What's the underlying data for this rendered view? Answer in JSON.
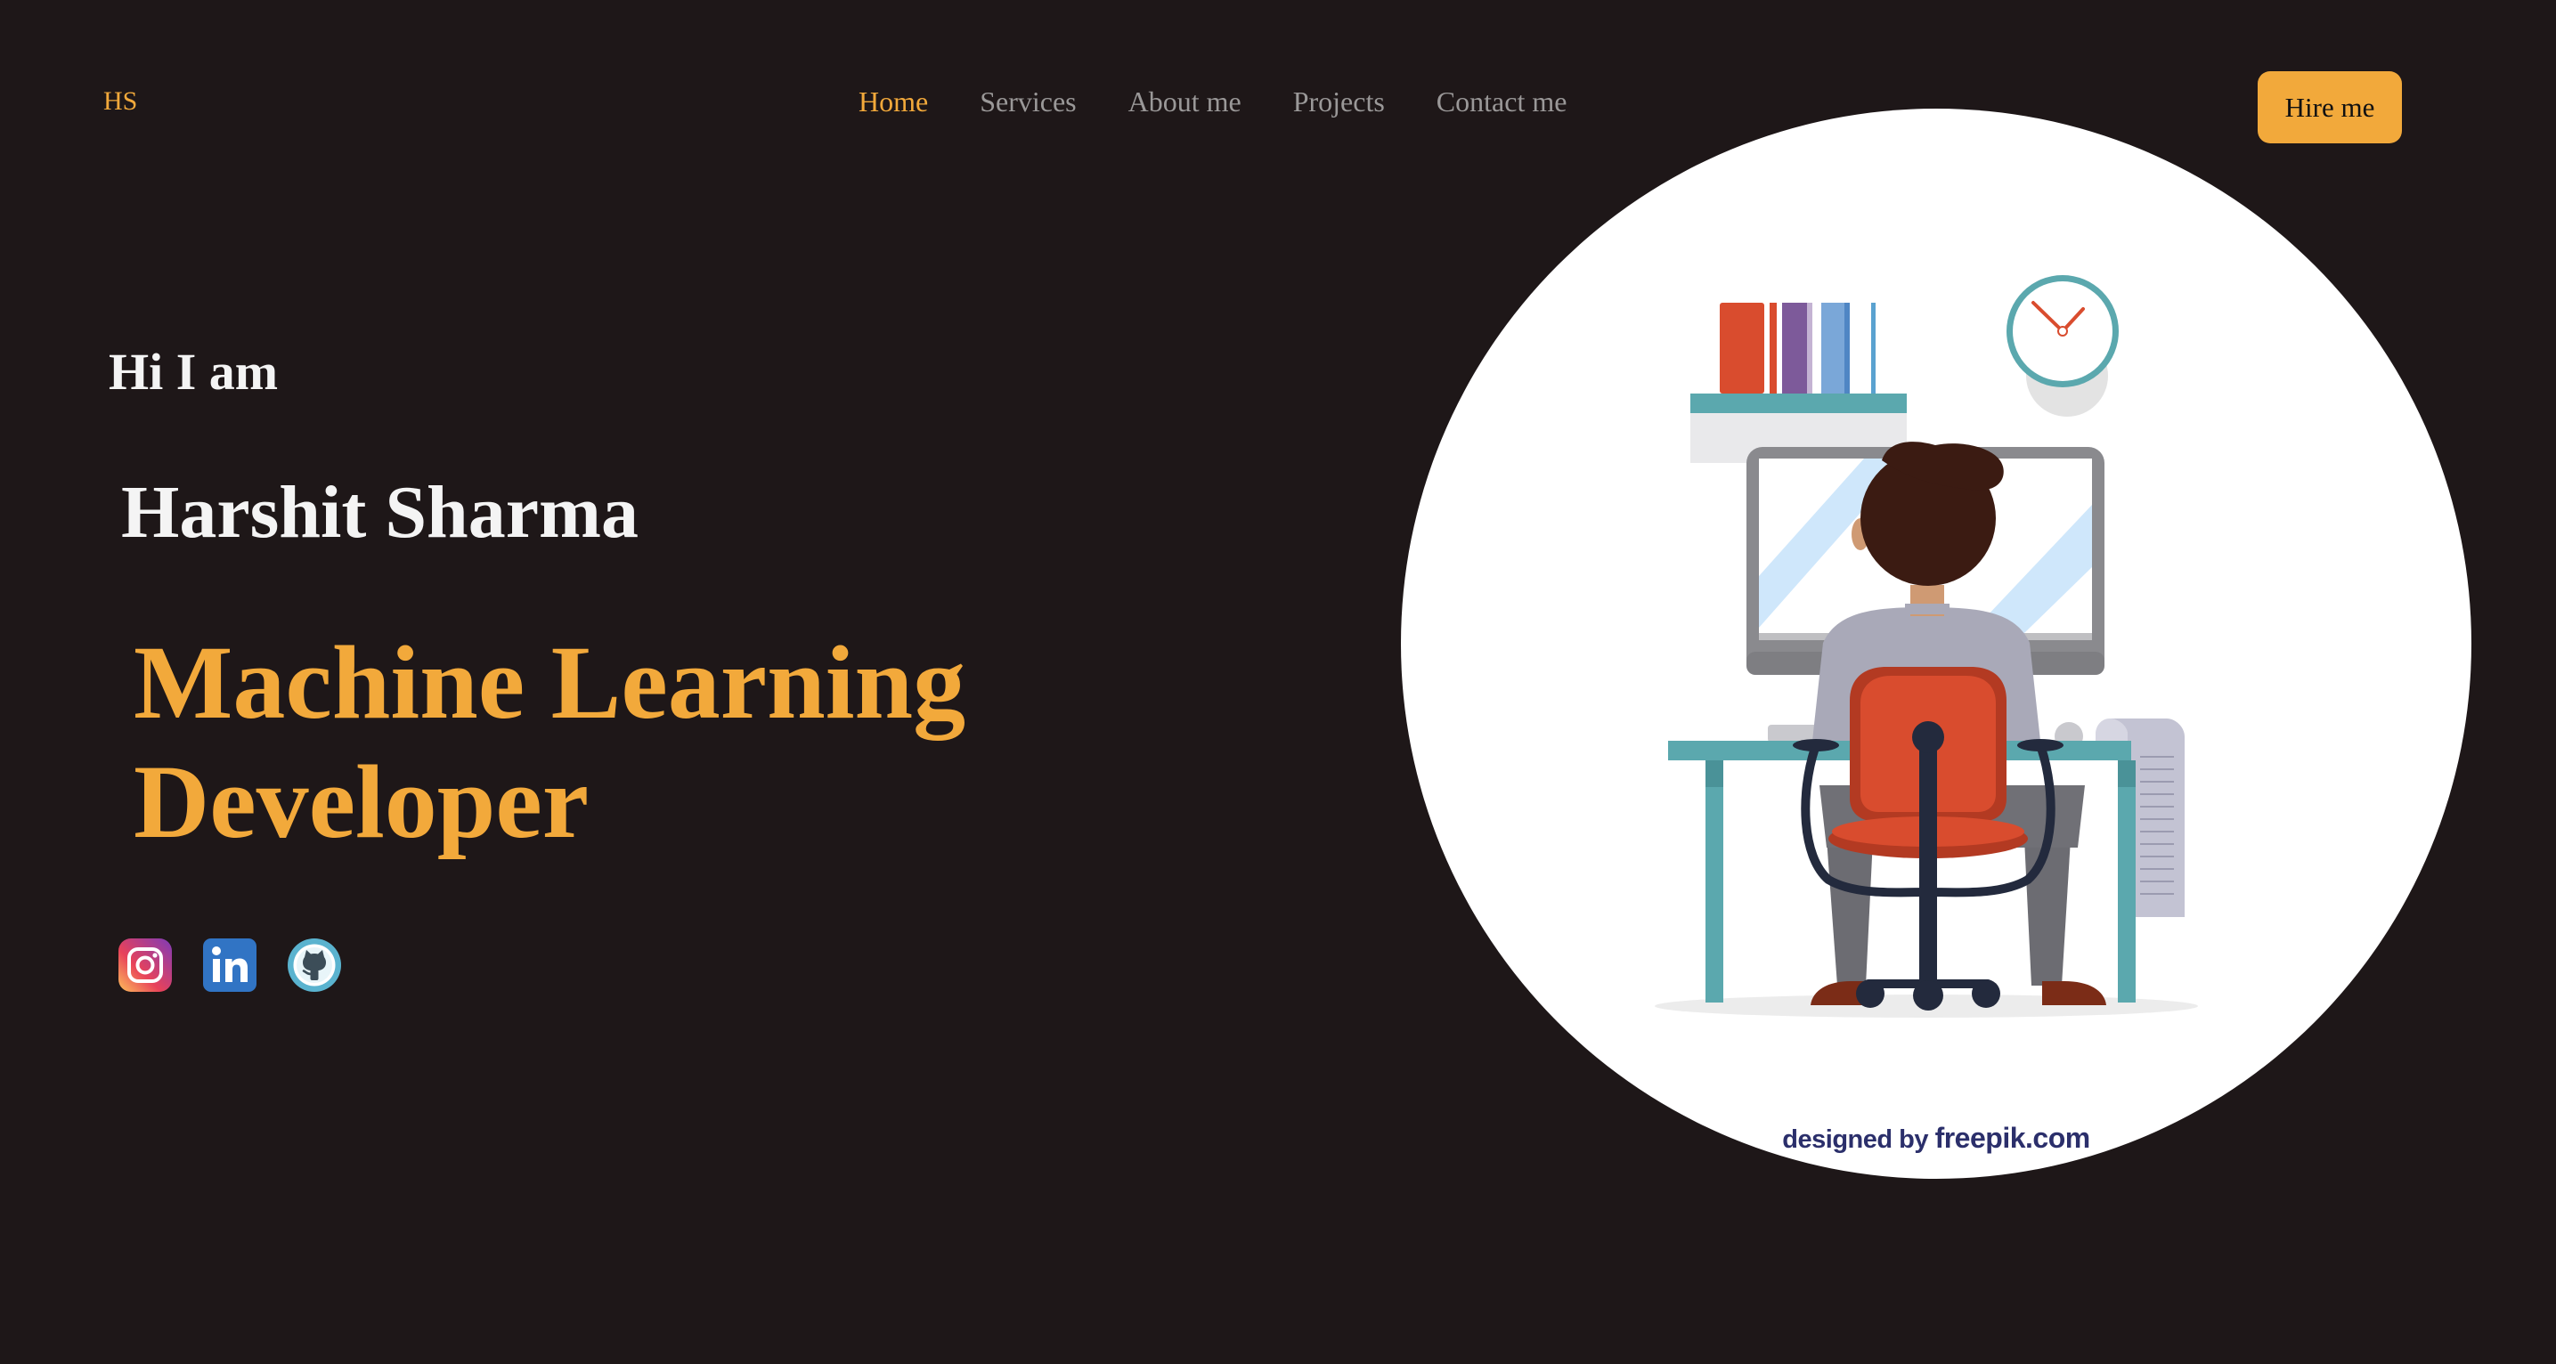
{
  "header": {
    "logo": "HS",
    "nav": [
      {
        "label": "Home",
        "active": true
      },
      {
        "label": "Services",
        "active": false
      },
      {
        "label": "About me",
        "active": false
      },
      {
        "label": "Projects",
        "active": false
      },
      {
        "label": "Contact me",
        "active": false
      }
    ],
    "cta_label": "Hire me"
  },
  "hero": {
    "greeting": "Hi I am",
    "name": "Harshit Sharma",
    "role_line1": "Machine Learning",
    "role_line2": "Developer"
  },
  "socials": [
    {
      "name": "instagram-icon"
    },
    {
      "name": "linkedin-icon"
    },
    {
      "name": "github-icon"
    }
  ],
  "illustration": {
    "credit_prefix": "designed by",
    "credit_brand": "freepik.com"
  },
  "colors": {
    "background": "#1e1718",
    "accent": "#f2a93b",
    "nav_inactive": "#9a9898",
    "text_primary": "#f4f4f4"
  }
}
